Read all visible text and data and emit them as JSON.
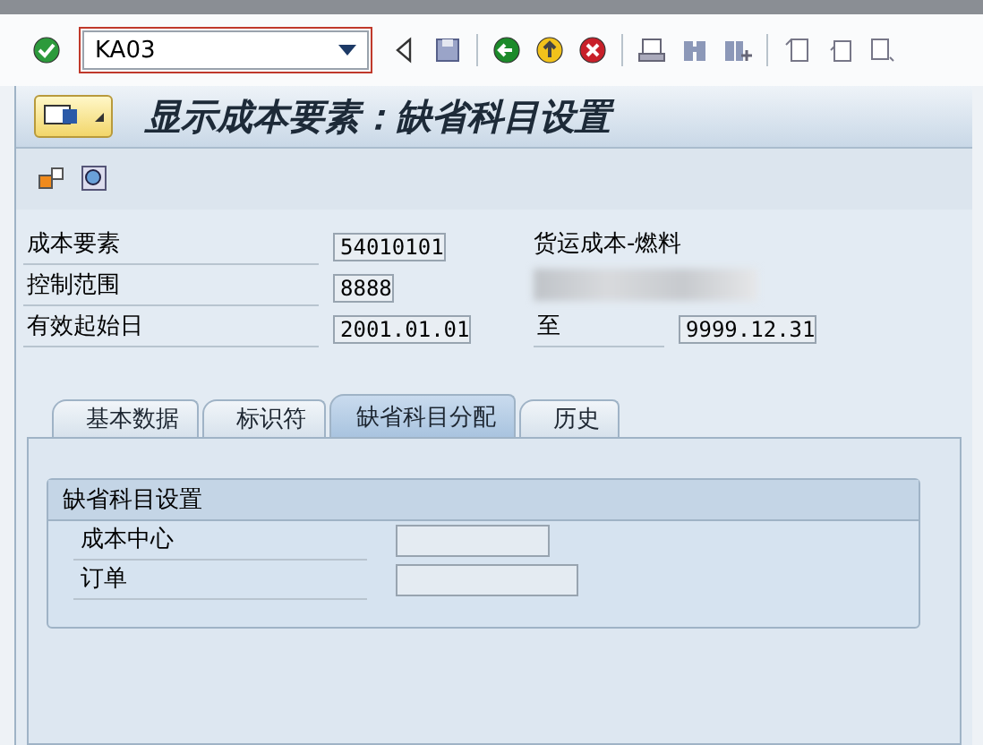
{
  "command_field": {
    "value": "KA03"
  },
  "title": "显示成本要素：缺省科目设置",
  "fields": [
    {
      "label": "成本要素",
      "value": "54010101",
      "description": "货运成本-燃料"
    },
    {
      "label": "控制范围",
      "value": "8888",
      "blurred": true
    },
    {
      "label": "有效起始日",
      "value": "2001.01.01",
      "to_label": "至",
      "to_value": "9999.12.31"
    }
  ],
  "tabs": [
    {
      "label": "基本数据",
      "selected": false
    },
    {
      "label": "标识符",
      "selected": false
    },
    {
      "label": "缺省科目分配",
      "selected": true
    },
    {
      "label": "历史",
      "selected": false
    }
  ],
  "group": {
    "title": "缺省科目设置",
    "rows": [
      {
        "label": "成本中心"
      },
      {
        "label": "订单"
      }
    ]
  }
}
